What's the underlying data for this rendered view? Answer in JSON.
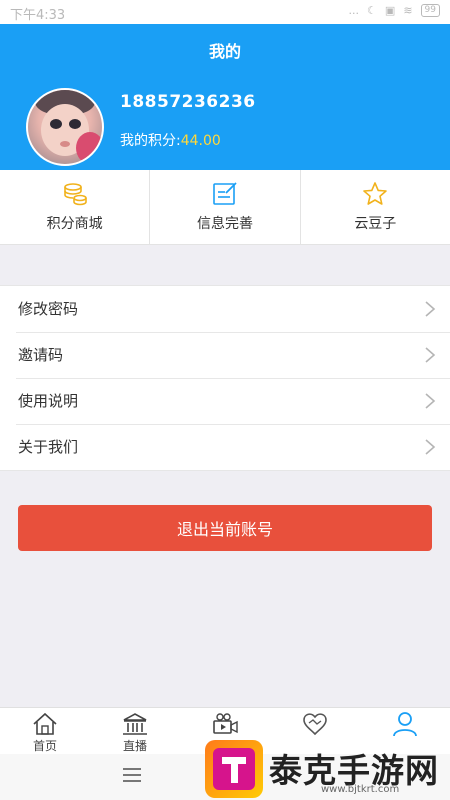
{
  "status_bar": {
    "time": "下午4:33",
    "indicators": "...",
    "battery": "99"
  },
  "header": {
    "title": "我的",
    "phone": "18857236236",
    "points_label": "我的积分:",
    "points_value": "44.00",
    "colors": {
      "background": "#1a9ff5",
      "points": "#ffd83a"
    }
  },
  "quick_actions": [
    {
      "label": "积分商城",
      "icon": "coin-stack-icon"
    },
    {
      "label": "信息完善",
      "icon": "edit-info-icon"
    },
    {
      "label": "云豆子",
      "icon": "star-icon"
    }
  ],
  "menu": [
    {
      "label": "修改密码"
    },
    {
      "label": "邀请码"
    },
    {
      "label": "使用说明"
    },
    {
      "label": "关于我们"
    }
  ],
  "logout_label": "退出当前账号",
  "tabs": [
    {
      "label": "首页",
      "icon": "home-icon"
    },
    {
      "label": "直播",
      "icon": "bank-icon"
    },
    {
      "label": "",
      "icon": "video-camera-icon"
    },
    {
      "label": "",
      "icon": "handshake-icon"
    },
    {
      "label": "",
      "icon": "user-icon",
      "active": true
    }
  ],
  "watermark": {
    "text": "泰克手游网",
    "url": "www.bjtkrt.com"
  }
}
